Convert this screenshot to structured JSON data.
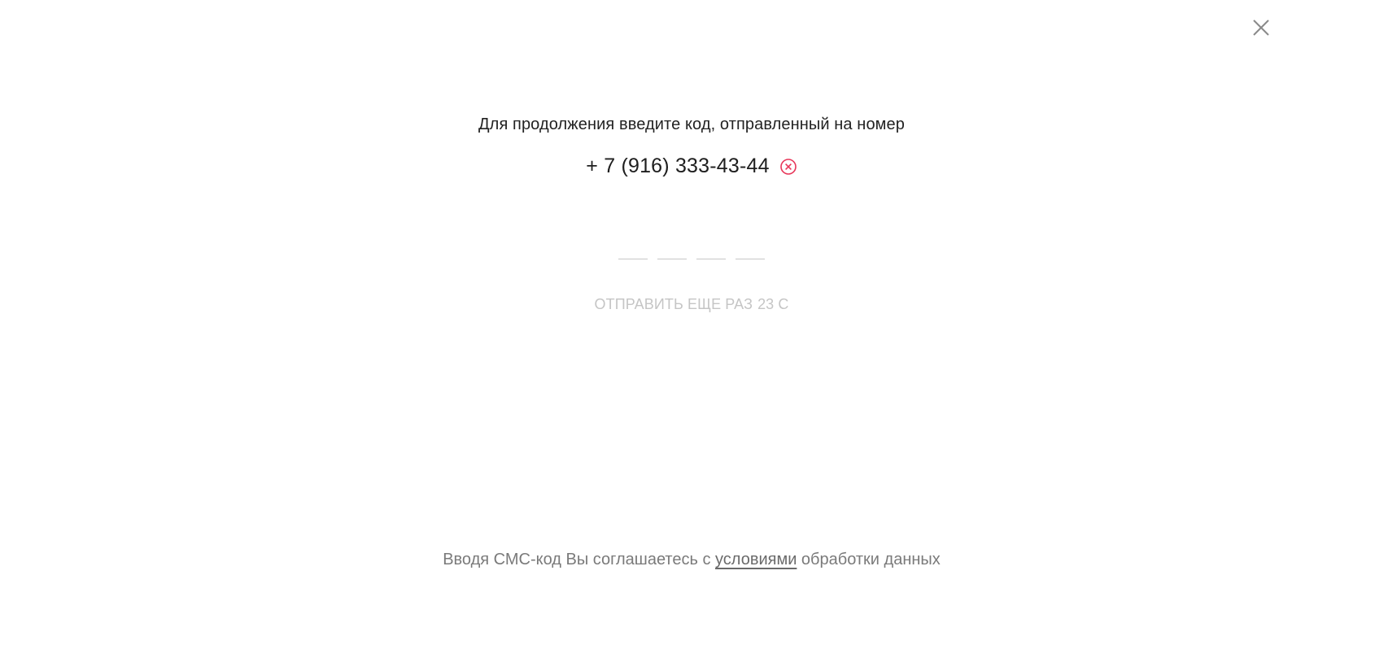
{
  "dialog": {
    "close_icon": "close-icon",
    "instruction": "Для продолжения введите код, отправленный на номер",
    "phone": "+ 7 (916) 333-43-44",
    "clear_phone_icon": "clear-circle-icon",
    "accent_color": "#e8375a",
    "code": {
      "length": 4,
      "values": [
        "",
        "",
        "",
        ""
      ]
    },
    "resend": {
      "label": "ОТПРАВИТЬ ЕЩЕ РАЗ",
      "timer": "23 С"
    },
    "terms": {
      "before": "Вводя СМС-код Вы соглашаетесь с ",
      "link": "условиями",
      "after": " обработки данных"
    }
  }
}
